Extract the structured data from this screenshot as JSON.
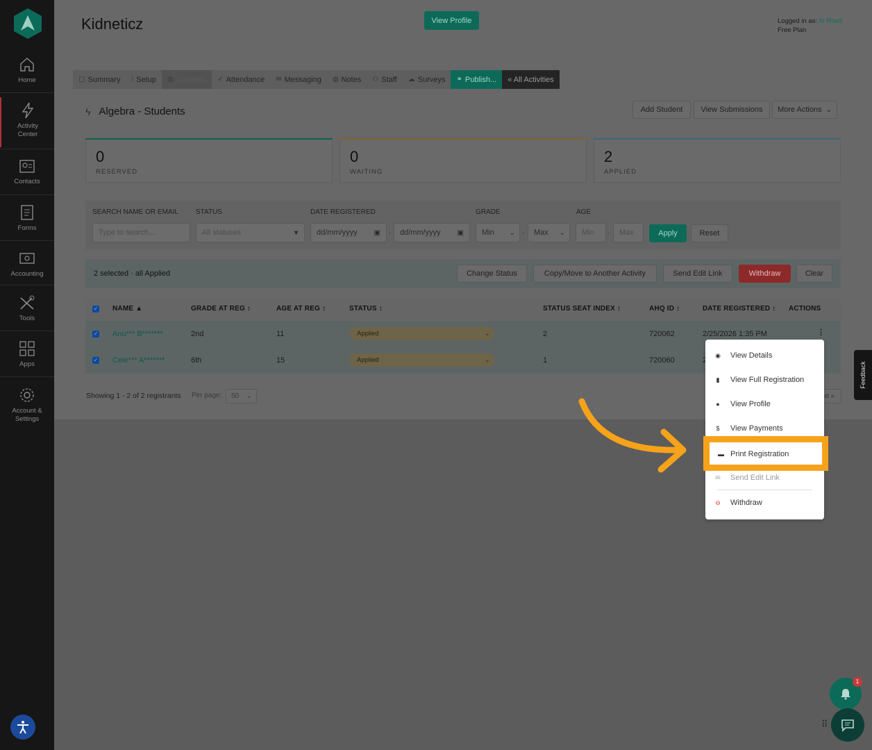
{
  "sidebar": {
    "items": [
      {
        "label": "Home",
        "icon": "home-icon"
      },
      {
        "label": "Activity Center",
        "icon": "bolt-icon"
      },
      {
        "label": "Contacts",
        "icon": "contacts-icon"
      },
      {
        "label": "Forms",
        "icon": "forms-icon"
      },
      {
        "label": "Accounting",
        "icon": "accounting-icon"
      },
      {
        "label": "Tools",
        "icon": "tools-icon"
      },
      {
        "label": "Apps",
        "icon": "apps-icon"
      },
      {
        "label": "Account & Settings",
        "icon": "gear-icon"
      }
    ]
  },
  "header": {
    "title": "Kidneticz",
    "view_profile": "View Profile",
    "logged_in_prefix": "Logged in as: ",
    "user": "Al Rhett",
    "plan": "Free Plan"
  },
  "tabs": [
    {
      "label": "Summary",
      "icon": "▢"
    },
    {
      "label": "Setup",
      "icon": "⁞"
    },
    {
      "label": "Students",
      "icon": "◎"
    },
    {
      "label": "Attendance",
      "icon": "✓"
    },
    {
      "label": "Messaging",
      "icon": "✉"
    },
    {
      "label": "Notes",
      "icon": "◍"
    },
    {
      "label": "Staff",
      "icon": "⚇"
    },
    {
      "label": "Surveys",
      "icon": "☁"
    },
    {
      "label": "Publish...",
      "icon": "🔗"
    },
    {
      "label": "« All Activities",
      "icon": ""
    }
  ],
  "card": {
    "title": "Algebra - Students",
    "add_student": "Add Student",
    "view_submissions": "View Submissions",
    "more_actions": "More Actions"
  },
  "stats": [
    {
      "value": "0",
      "label": "RESERVED",
      "color": "#0e6a58"
    },
    {
      "value": "0",
      "label": "WAITING",
      "color": "#8a6a2a"
    },
    {
      "value": "2",
      "label": "APPLIED",
      "color": "#3a6a8a"
    }
  ],
  "filters": {
    "search_label": "SEARCH NAME OR EMAIL",
    "search_placeholder": "Type to search...",
    "status_label": "STATUS",
    "status_value": "All statuses",
    "date_label": "DATE REGISTERED",
    "date_from": "dd/mm/yyyy",
    "date_to": "dd/mm/yyyy",
    "grade_label": "GRADE",
    "grade_min": "Min",
    "grade_max": "Max",
    "age_label": "AGE",
    "age_min": "Min",
    "age_max": "Max",
    "apply": "Apply",
    "reset": "Reset"
  },
  "bulk": {
    "text": "2 selected · all Applied",
    "change_status": "Change Status",
    "copy_move": "Copy/Move to Another Activity",
    "send_edit_link": "Send Edit Link",
    "withdraw": "Withdraw",
    "clear": "Clear"
  },
  "table": {
    "headers": {
      "name": "NAME ▲",
      "grade": "GRADE AT REG ↕",
      "age": "AGE AT REG ↕",
      "status": "STATUS ↕",
      "seat": "STATUS SEAT INDEX ↕",
      "ahq": "AHQ ID ↕",
      "date": "DATE REGISTERED ↕",
      "actions": "ACTIONS"
    },
    "rows": [
      {
        "name": "Anu*** B*******",
        "grade": "2nd",
        "age": "11",
        "status": "Applied",
        "seat": "2",
        "ahq": "720062",
        "date": "2/25/2026 1:35 PM"
      },
      {
        "name": "Cele*** A*******",
        "grade": "6th",
        "age": "15",
        "status": "Applied",
        "seat": "1",
        "ahq": "720060",
        "date": "2"
      }
    ]
  },
  "footer": {
    "showing": "Showing 1 - 2 of 2 registrants",
    "per_page_label": "Per page:",
    "per_page_value": "50",
    "next": "xt »"
  },
  "menu": {
    "items": [
      {
        "label": "View Details",
        "icon": "eye-icon"
      },
      {
        "label": "View Full Registration",
        "icon": "document-icon"
      },
      {
        "label": "View Profile",
        "icon": "user-icon"
      },
      {
        "label": "View Payments",
        "icon": "dollar-icon"
      },
      {
        "label": "Print Registration",
        "icon": "printer-icon"
      },
      {
        "label": "Send Edit Link",
        "icon": "mail-icon"
      },
      {
        "label": "Withdraw",
        "icon": "minus-circle-icon"
      }
    ]
  },
  "feedback": "Feedback",
  "notifications_count": "1",
  "colors": {
    "accent": "#0e6a58",
    "highlight": "#f6a21a",
    "danger": "#8c2a2a"
  }
}
